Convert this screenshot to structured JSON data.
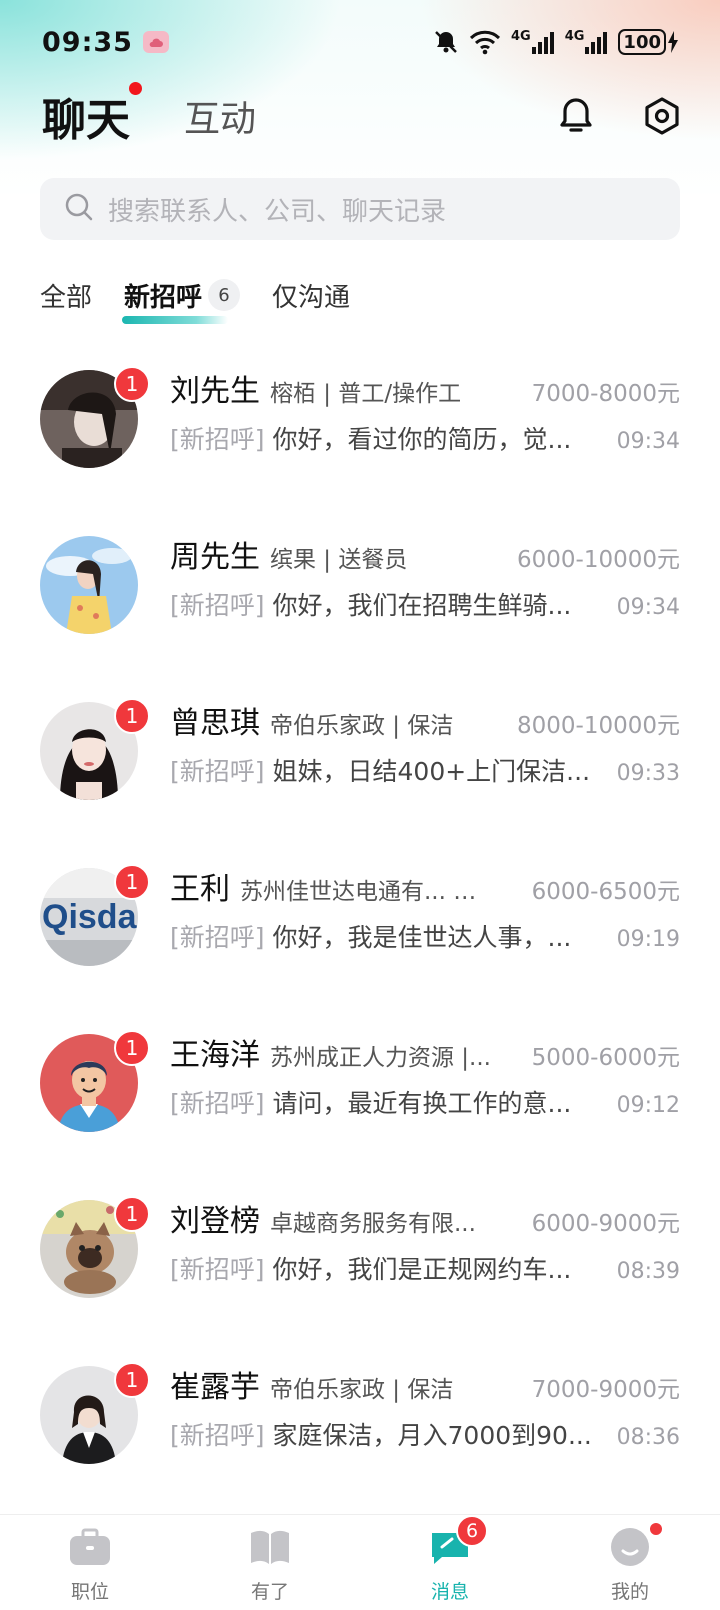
{
  "status_bar": {
    "time": "09:35",
    "network_1": "4G",
    "network_2": "4G",
    "battery": "100"
  },
  "header": {
    "tab_chat": "聊天",
    "tab_interact": "互动"
  },
  "search": {
    "placeholder": "搜索联系人、公司、聊天记录"
  },
  "filters": {
    "all": "全部",
    "new_greeting": "新招呼",
    "new_greeting_count": "6",
    "only_chat": "仅沟通"
  },
  "chats": [
    {
      "name": "刘先生",
      "company": "榕栢 | 普工/操作工",
      "salary": "7000-8000元",
      "tag": "[新招呼]",
      "preview": "你好，看过你的简历，觉...",
      "time": "09:34",
      "unread": "1"
    },
    {
      "name": "周先生",
      "company": "缤果 | 送餐员",
      "salary": "6000-10000元",
      "tag": "[新招呼]",
      "preview": "你好，我们在招聘生鲜骑...",
      "time": "09:34",
      "unread": ""
    },
    {
      "name": "曾思琪",
      "company": "帝伯乐家政 | 保洁",
      "salary": "8000-10000元",
      "tag": "[新招呼]",
      "preview": "姐妹，日结400+上门保洁...",
      "time": "09:33",
      "unread": "1"
    },
    {
      "name": "王利",
      "company": "苏州佳世达电通有... |...",
      "salary": "6000-6500元",
      "tag": "[新招呼]",
      "preview": "你好，我是佳世达人事，...",
      "time": "09:19",
      "unread": "1"
    },
    {
      "name": "王海洋",
      "company": "苏州成正人力资源 |...",
      "salary": "5000-6000元",
      "tag": "[新招呼]",
      "preview": "请问，最近有换工作的意...",
      "time": "09:12",
      "unread": "1"
    },
    {
      "name": "刘登榜",
      "company": "卓越商务服务有限...",
      "salary": "6000-9000元",
      "tag": "[新招呼]",
      "preview": "你好，我们是正规网约车...",
      "time": "08:39",
      "unread": "1"
    },
    {
      "name": "崔露芋",
      "company": "帝伯乐家政 | 保洁",
      "salary": "7000-9000元",
      "tag": "[新招呼]",
      "preview": "家庭保洁，月入7000到90...",
      "time": "08:36",
      "unread": "1"
    }
  ],
  "bottom_nav": {
    "jobs": "职位",
    "youle": "有了",
    "messages": "消息",
    "messages_badge": "6",
    "mine": "我的"
  },
  "colors": {
    "accent": "#18b3ad",
    "badge_red": "#f0383c"
  }
}
